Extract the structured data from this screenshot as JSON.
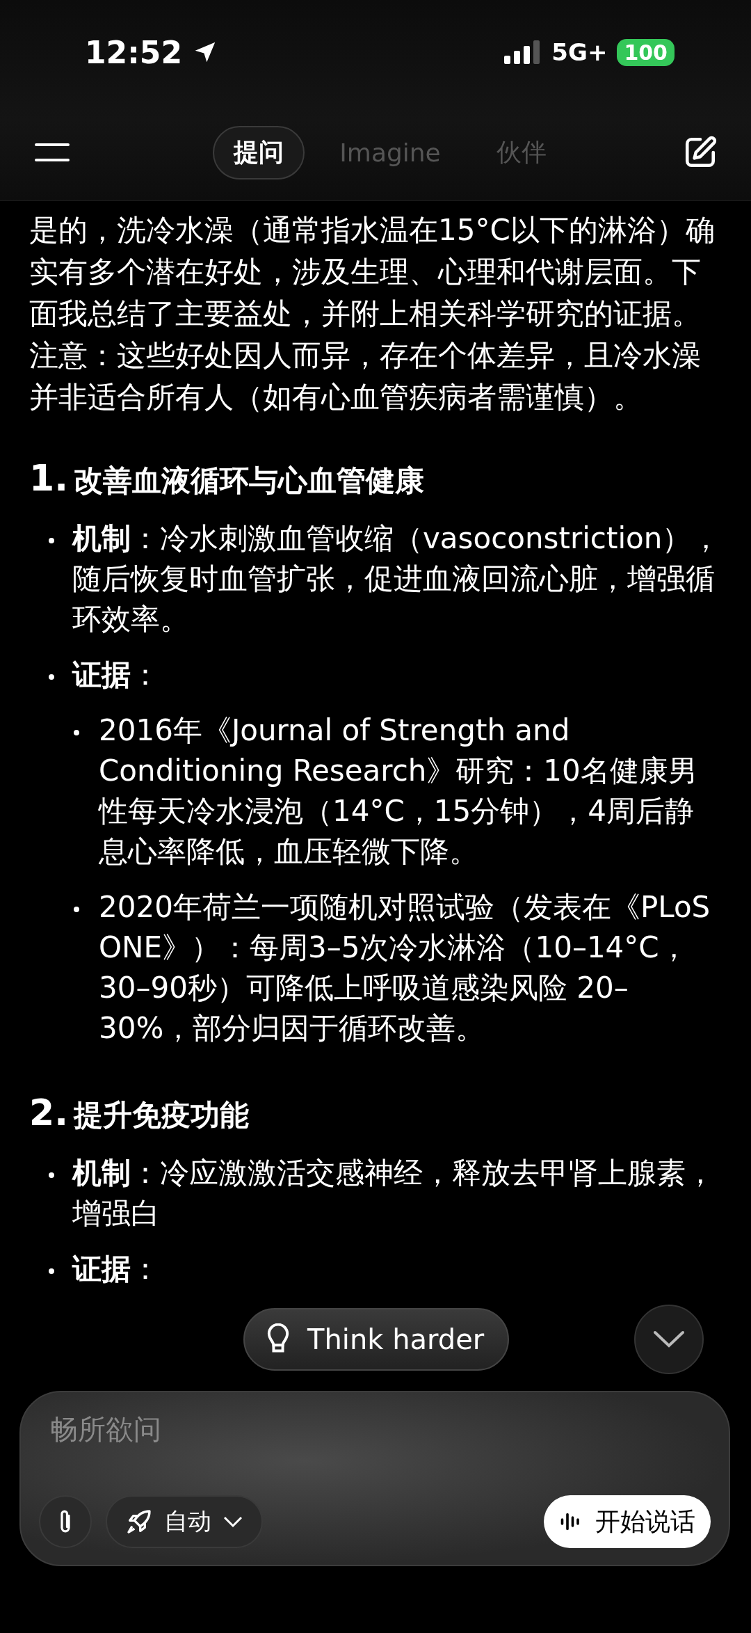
{
  "status_bar": {
    "time": "12:52",
    "network": "5G+",
    "battery": "100"
  },
  "tabs": [
    {
      "label": "提问",
      "selected": true
    },
    {
      "label": "Imagine",
      "selected": false
    },
    {
      "label": "伙伴",
      "selected": false
    }
  ],
  "message": {
    "intro": "是的，洗冷水澡（通常指水温在15°C以下的淋浴）确实有多个潜在好处，涉及生理、心理和代谢层面。下面我总结了主要益处，并附上相关科学研究的证据。注意：这些好处因人而异，存在个体差异，且冷水澡并非适合所有人（如有心血管疾病者需谨慎）。",
    "sections": [
      {
        "number": "1.",
        "title": "改善血液循环与心血管健康",
        "items": [
          {
            "text": "**机制**：冷水刺激血管收缩（vasoconstriction），随后恢复时血管扩张，促进血液回流心脏，增强循环效率。"
          },
          {
            "text": "**证据**：",
            "children": [
              {
                "text": "2016年《Journal of Strength and Conditioning Research》研究：10名健康男性每天冷水浸泡（14°C，15分钟），4周后静息心率降低，血压轻微下降。"
              },
              {
                "text": "2020年荷兰一项随机对照试验（发表在《PLoS ONE》）：每周3–5次冷水淋浴（10–14°C，30–90秒）可降低上呼吸道感染风险 20–30%，部分归因于循环改善。"
              }
            ]
          }
        ]
      },
      {
        "number": "2.",
        "title": "提升免疫功能",
        "items": [
          {
            "text": "**机制**：冷应激激活交感神经，释放去甲肾上腺素，增强白"
          },
          {
            "text": "**证据**："
          }
        ]
      }
    ]
  },
  "think_button": "Think harder",
  "composer": {
    "placeholder": "畅所欲问",
    "mode": "自动",
    "voice_button": "开始说话"
  }
}
